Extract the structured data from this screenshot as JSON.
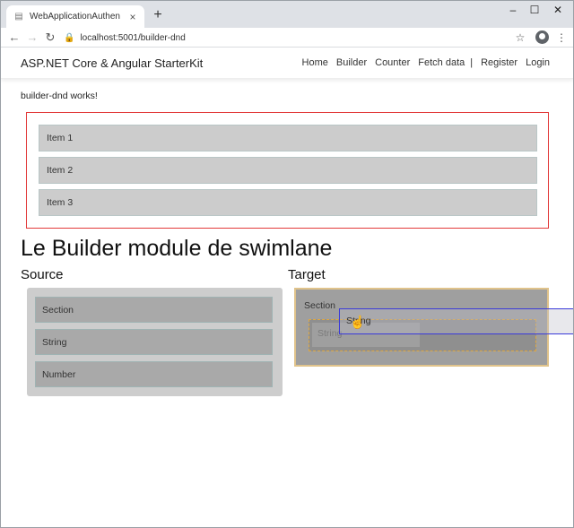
{
  "browser": {
    "tab_title": "WebApplicationAuthen",
    "tab_close": "×",
    "new_tab": "+",
    "url": "localhost:5001/builder-dnd",
    "window_controls": {
      "minimize": "–",
      "maximize": "☐",
      "close": "✕"
    },
    "nav": {
      "back": "←",
      "forward": "→",
      "reload": "↻"
    },
    "icons": {
      "lock": "🔒",
      "star": "☆",
      "menu": "⋮",
      "favicon": "▤"
    }
  },
  "app": {
    "brand": "ASP.NET Core & Angular StarterKit",
    "nav_links": [
      "Home",
      "Builder",
      "Counter",
      "Fetch data"
    ],
    "separator": "|",
    "auth_links": [
      "Register",
      "Login"
    ]
  },
  "page": {
    "status_text": "builder-dnd works!",
    "items": [
      "Item 1",
      "Item 2",
      "Item 3"
    ],
    "heading": "Le Builder module de swimlane",
    "source_title": "Source",
    "target_title": "Target",
    "source_items": [
      "Section",
      "String",
      "Number"
    ],
    "target_section_label": "Section",
    "placeholder_label": "String",
    "drag_preview_label": "String"
  },
  "colors": {
    "red_border": "#e23a3a",
    "drop_highlight": "#e0a840",
    "drag_outline": "#3b3bd9"
  }
}
